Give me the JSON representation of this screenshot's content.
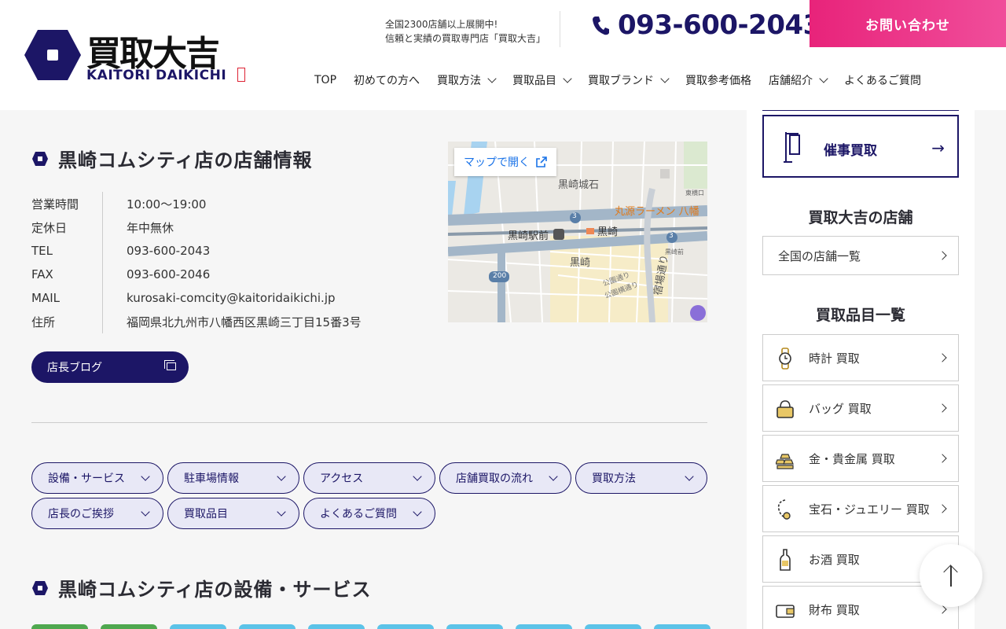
{
  "brand": {
    "name_jp": "買取大吉",
    "name_en": "KAITORI DAIKICHI"
  },
  "header": {
    "tagline_1": "全国2300店舗以上展開中!",
    "tagline_2": "信頼と実績の買取専門店「買取大吉」",
    "phone": "093-600-2043",
    "contact_label": "お問い合わせ",
    "nav": [
      {
        "label": "TOP"
      },
      {
        "label": "初めての方へ"
      },
      {
        "label": "買取方法"
      },
      {
        "label": "買取品目"
      },
      {
        "label": "買取ブランド"
      },
      {
        "label": "買取参考価格"
      },
      {
        "label": "店舗紹介"
      },
      {
        "label": "よくあるご質問"
      }
    ]
  },
  "store": {
    "title": "黒崎コムシティ店の店舗情報",
    "rows": [
      {
        "label": "営業時間",
        "value": "10:00〜19:00"
      },
      {
        "label": "定休日",
        "value": "年中無休"
      },
      {
        "label": "TEL",
        "value": "093-600-2043"
      },
      {
        "label": "FAX",
        "value": "093-600-2046"
      },
      {
        "label": "MAIL",
        "value": "kurosaki-comcity@kaitoridaikichi.jp"
      },
      {
        "label": "住所",
        "value": "福岡県北九州市八幡西区黒崎三丁目15番3号"
      }
    ],
    "blog_label": "店長ブログ"
  },
  "map": {
    "open_label": "マップで開く",
    "labels": {
      "castle": "黒崎城石",
      "ramen": "丸源ラーメン 八幡",
      "station": "黒崎駅前",
      "jr": "黒崎",
      "area": "黒崎",
      "street": "宿場通り",
      "park1": "公園通り",
      "park2": "公園横通り",
      "route3": "3",
      "route200": "200",
      "east": "東横口",
      "higashi": "黒崎前"
    }
  },
  "tabs": [
    {
      "label": "設備・サービス"
    },
    {
      "label": "駐車場情報"
    },
    {
      "label": "アクセス"
    },
    {
      "label": "店舗買取の流れ"
    },
    {
      "label": "買取方法"
    },
    {
      "label": "店長のご挨拶"
    },
    {
      "label": "買取品目"
    },
    {
      "label": "よくあるご質問"
    }
  ],
  "facilities_title": "黒崎コムシティ店の設備・サービス",
  "colors": {
    "navy": "#1c1666",
    "pink": "#e8237a",
    "gold": "#b58a1e",
    "tag_green": "#4fa84f",
    "tag_blue": "#5cc3e8"
  },
  "sidebar": {
    "event_label": "催事買取",
    "stores_heading": "買取大吉の店舗",
    "stores_link": "全国の店舗一覧",
    "items_heading": "買取品目一覧",
    "items": [
      {
        "label": "時計 買取",
        "icon": "watch-icon"
      },
      {
        "label": "バッグ 買取",
        "icon": "bag-icon"
      },
      {
        "label": "金・貴金属 買取",
        "icon": "gold-bars-icon"
      },
      {
        "label": "宝石・ジュエリー 買取",
        "icon": "jewelry-icon"
      },
      {
        "label": "お酒 買取",
        "icon": "bottle-icon"
      },
      {
        "label": "財布 買取",
        "icon": "wallet-icon"
      }
    ]
  }
}
